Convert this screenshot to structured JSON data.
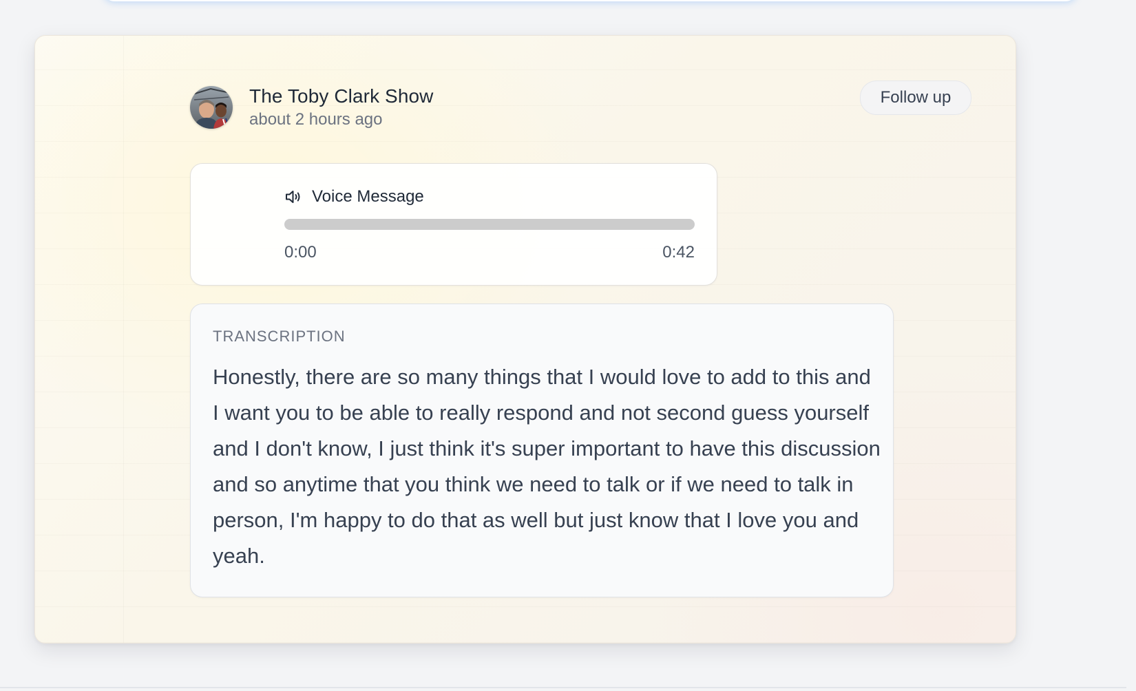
{
  "post": {
    "author_name": "The Toby Clark Show",
    "timestamp": "about 2 hours ago",
    "follow_label": "Follow up"
  },
  "voice_message": {
    "title": "Voice Message",
    "icon": "speaker-icon",
    "current_time": "0:00",
    "duration": "0:42",
    "progress": 0
  },
  "transcription": {
    "label": "TRANSCRIPTION",
    "text": "Honestly, there are so many things that I would love to add to this and I want you to be able to really respond and not second guess yourself and I don't know, I just think it's super important to have this discussion and so anytime that you think we need to talk or if we need to talk in person, I'm happy to do that as well but just know that I love you and yeah."
  },
  "colors": {
    "progress_track": "#cccccc",
    "label_gray": "#6b7280",
    "text_dark": "#1f2937"
  }
}
